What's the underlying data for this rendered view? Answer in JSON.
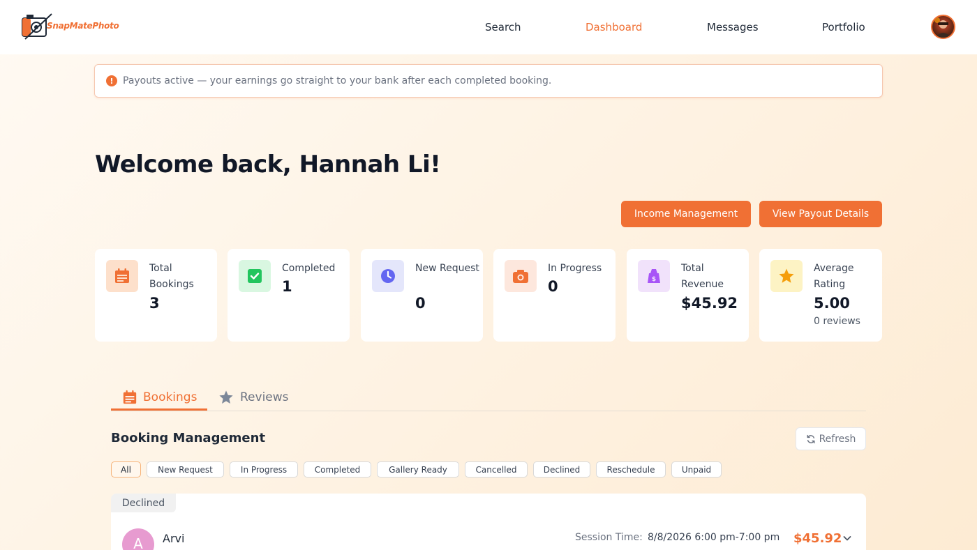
{
  "app": {
    "brand": "SnapMatePhoto",
    "accent": "#f07034"
  },
  "nav": {
    "items": [
      {
        "label": "Search"
      },
      {
        "label": "Dashboard",
        "active": true
      },
      {
        "label": "Messages"
      },
      {
        "label": "Portfolio"
      }
    ]
  },
  "banner": {
    "icon": "alert-circle-icon",
    "text": "Payouts active — your earnings go straight to your bank after each completed booking."
  },
  "welcome": "Welcome back, Hannah Li!",
  "actions": {
    "income_label": "Income Management",
    "payout_label": "View Payout Details"
  },
  "stats": [
    {
      "label": "Total Bookings",
      "value": "3",
      "icon": "calendar-icon",
      "color": "#f07034",
      "bg": "#fde0cb"
    },
    {
      "label": "Completed",
      "value": "1",
      "icon": "check-square-icon",
      "color": "#22c55e",
      "bg": "#d9f7e1"
    },
    {
      "label": "New Request",
      "value": "0",
      "icon": "clock-icon",
      "color": "#6366f1",
      "bg": "#e4e6fb"
    },
    {
      "label": "In Progress",
      "value": "0",
      "icon": "camera-icon",
      "color": "#f07034",
      "bg": "#fde7dd"
    },
    {
      "label": "Total Revenue",
      "value": "$45.92",
      "icon": "money-bag-icon",
      "color": "#a855f7",
      "bg": "#f1e2fb"
    },
    {
      "label": "Average Rating",
      "value": "5.00",
      "sub": "0 reviews",
      "icon": "star-icon",
      "color": "#f59e0b",
      "bg": "#fdf3c4"
    }
  ],
  "tabs": [
    {
      "label": "Bookings",
      "icon": "calendar-icon",
      "active": true
    },
    {
      "label": "Reviews",
      "icon": "star-icon",
      "active": false
    }
  ],
  "booking_management": {
    "title": "Booking Management",
    "refresh_label": "Refresh",
    "filters": [
      {
        "label": "All",
        "active": true
      },
      {
        "label": "New Request"
      },
      {
        "label": "In Progress"
      },
      {
        "label": "Completed"
      },
      {
        "label": "Gallery Ready"
      },
      {
        "label": "Cancelled"
      },
      {
        "label": "Declined"
      },
      {
        "label": "Reschedule"
      },
      {
        "label": "Unpaid"
      }
    ],
    "bookings": [
      {
        "status": "Declined",
        "client_initial": "A",
        "client_name": "Arvi",
        "session_label": "Session Time:",
        "session_time": "8/8/2026 6:00 pm-7:00 pm",
        "price": "$45.92"
      }
    ]
  }
}
